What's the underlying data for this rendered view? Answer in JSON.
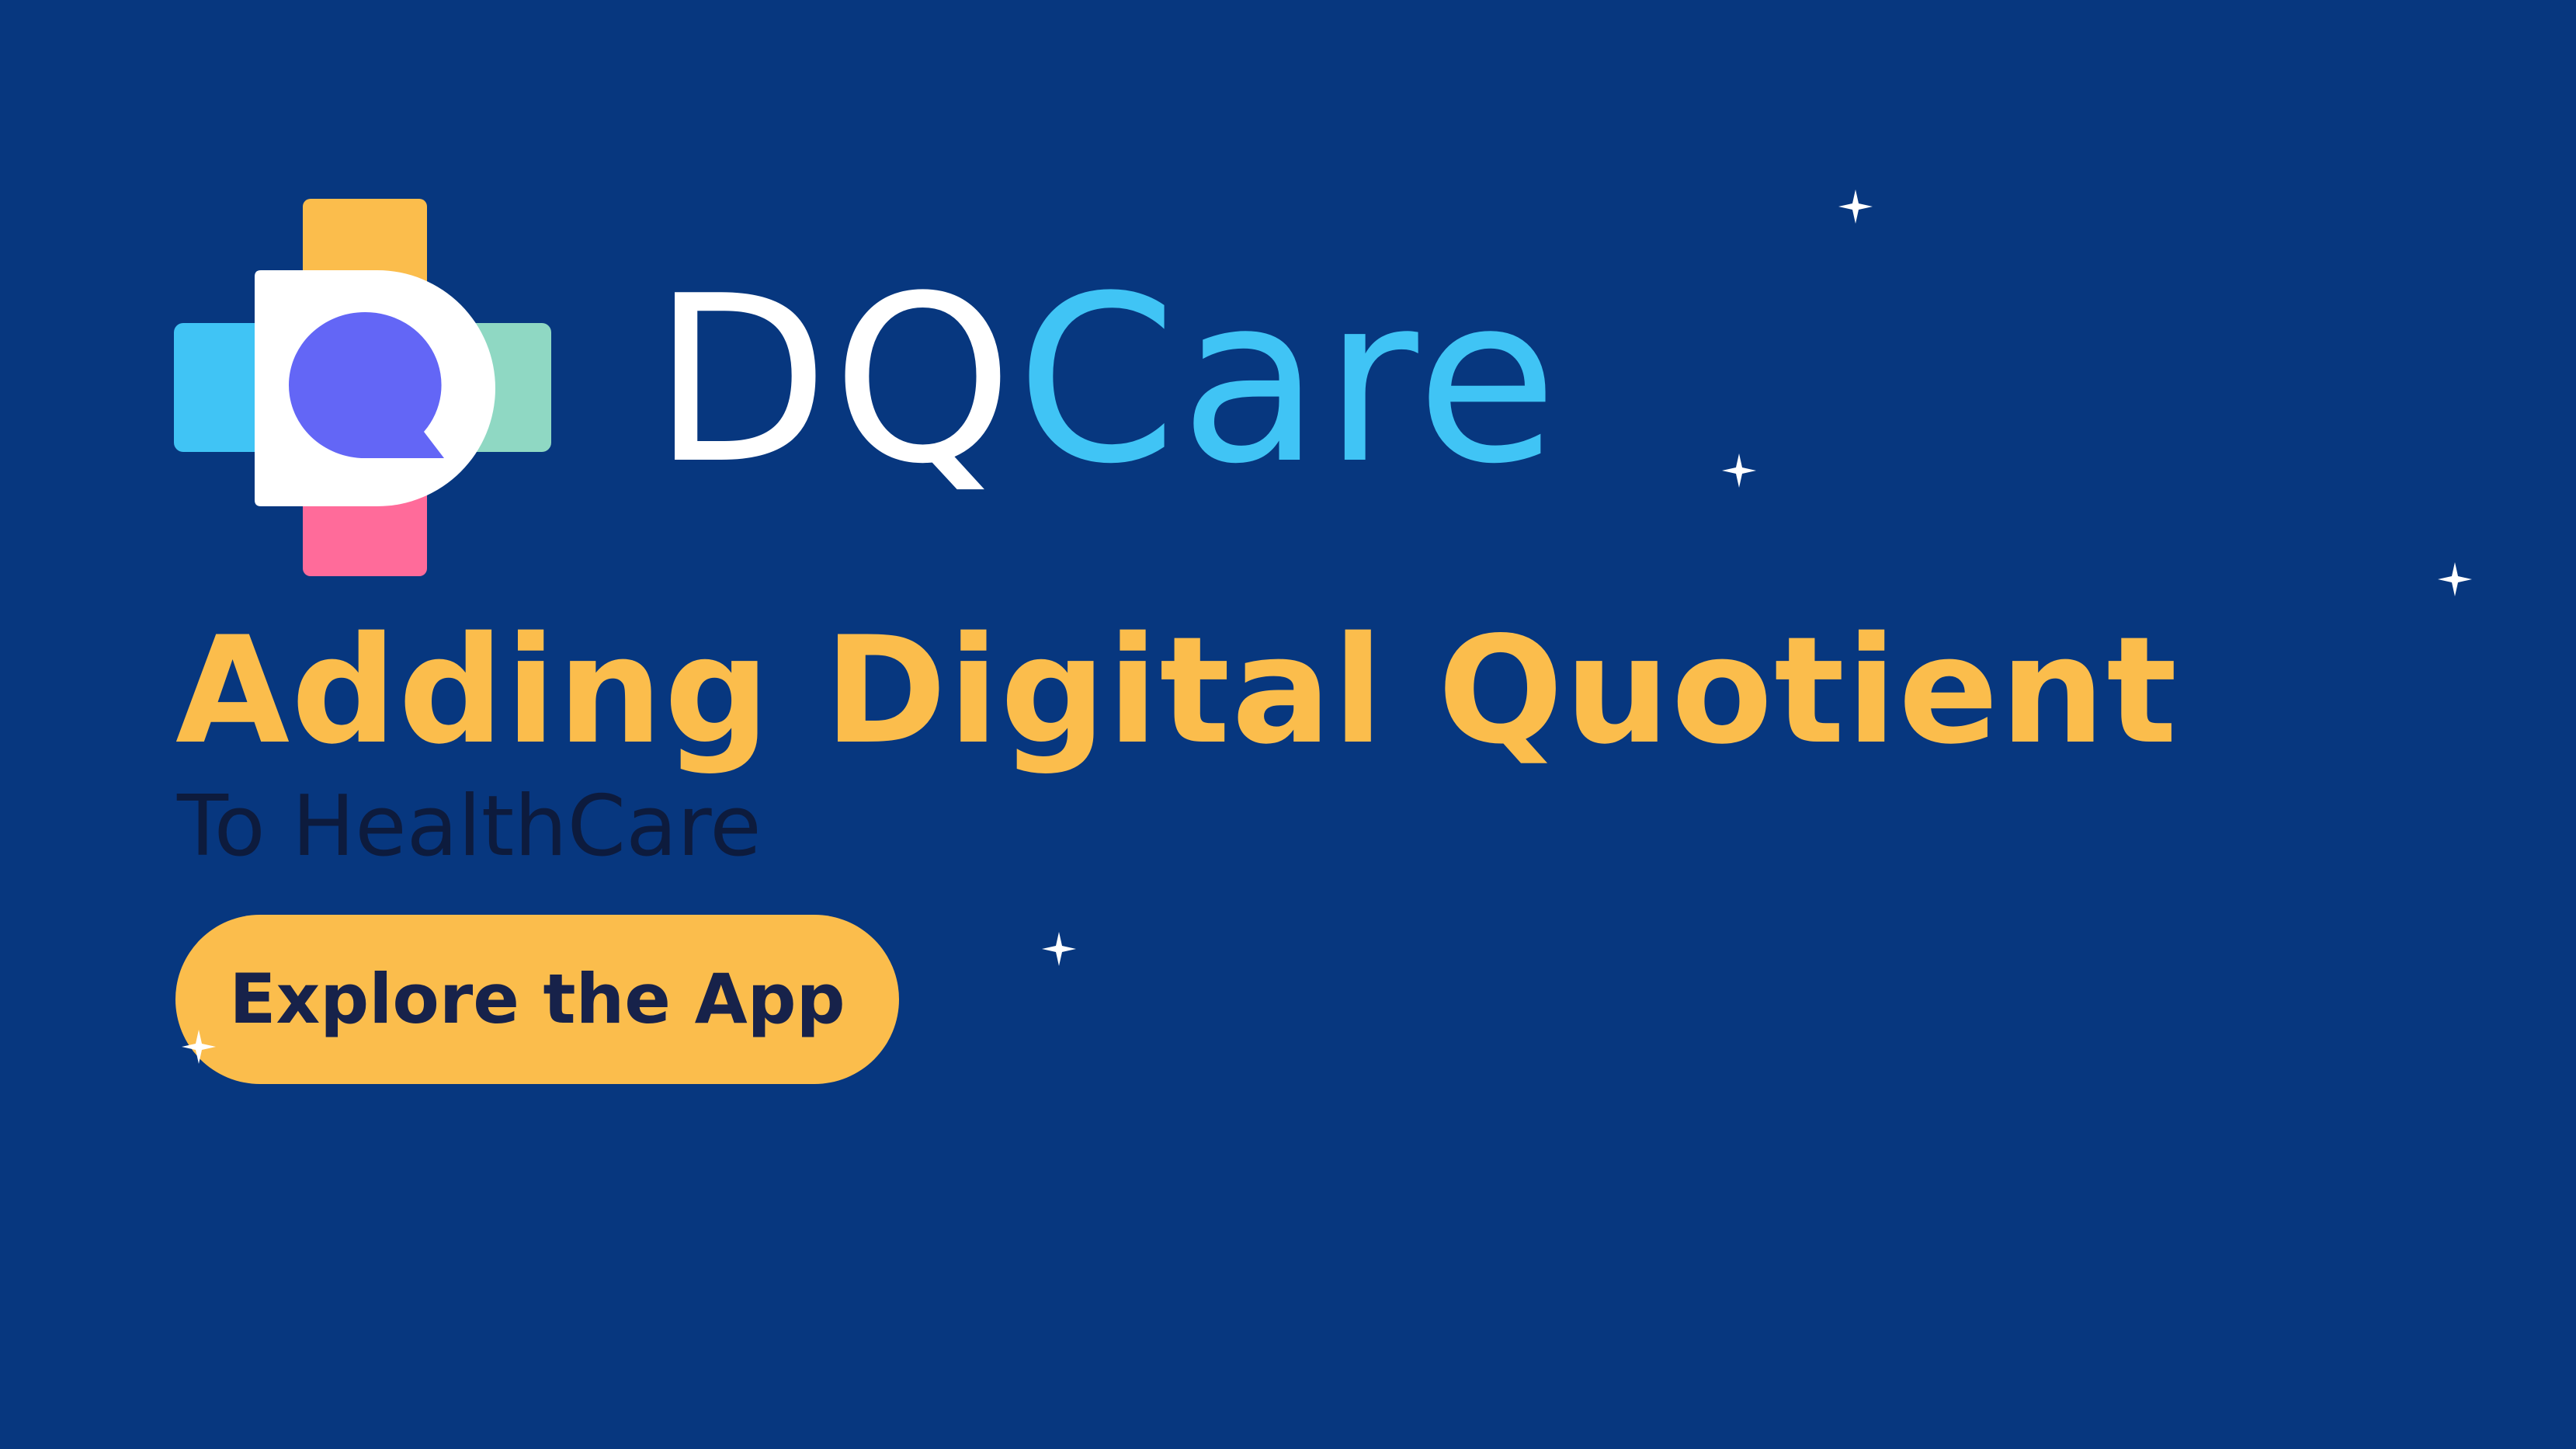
{
  "brand": {
    "name_part_a": "DQ",
    "name_part_b": "Care",
    "logo_icon": "medical-cross-chat-icon"
  },
  "hero": {
    "headline": "Adding Digital Quotient",
    "subheadline": "To HealthCare"
  },
  "cta": {
    "label": "Explore the App"
  },
  "decorations": {
    "sparkle_icon": "sparkle-icon"
  },
  "colors": {
    "background": "#07377f",
    "headline": "#fbbd4c",
    "cta_background": "#fbbd4c",
    "cta_text": "#17224a",
    "subheadline": "#0d1b3d",
    "brand_white": "#ffffff",
    "brand_blue": "#40c4f5",
    "cross_top": "#fbbd4c",
    "cross_left": "#40c4f5",
    "cross_right": "#8fd8c3",
    "cross_bottom": "#ff6b9a",
    "chat_bubble": "#6366f6"
  }
}
